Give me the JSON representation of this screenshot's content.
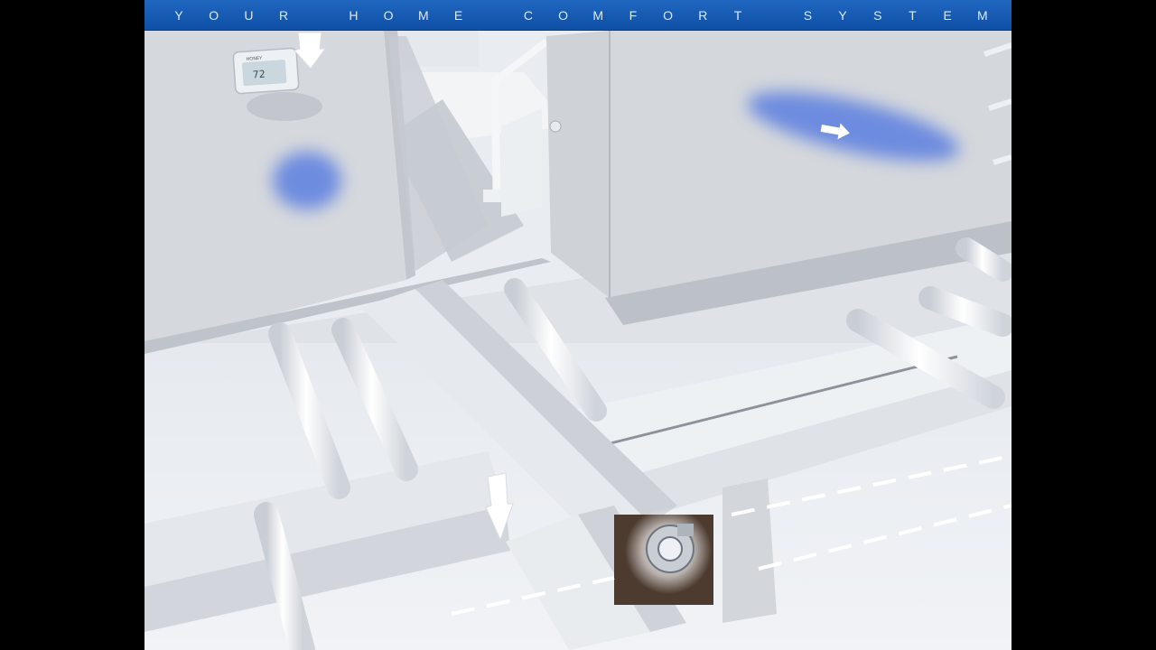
{
  "title_bar": {
    "text": "YOUR HOME COMFORT SYSTEM",
    "letters": [
      "Y",
      "O",
      "U",
      "R",
      "",
      "H",
      "O",
      "M",
      "E",
      "",
      "C",
      "O",
      "M",
      "F",
      "O",
      "R",
      "T",
      "",
      "S",
      "Y",
      "S",
      "T",
      "E",
      "M"
    ]
  },
  "thermostat": {
    "brand": "HONEY",
    "temperature": "72"
  },
  "colors": {
    "title_bar": "#1565c0",
    "airflow": "#5b7fe0",
    "walls": "#d8dbe0",
    "background": "#000000"
  },
  "icons": {
    "pointer_top": "white-hand-pointer-icon",
    "pointer_mid": "white-hand-pointer-icon",
    "flow_arrow": "white-arrow-icon",
    "blower": "blower-fan-icon"
  }
}
